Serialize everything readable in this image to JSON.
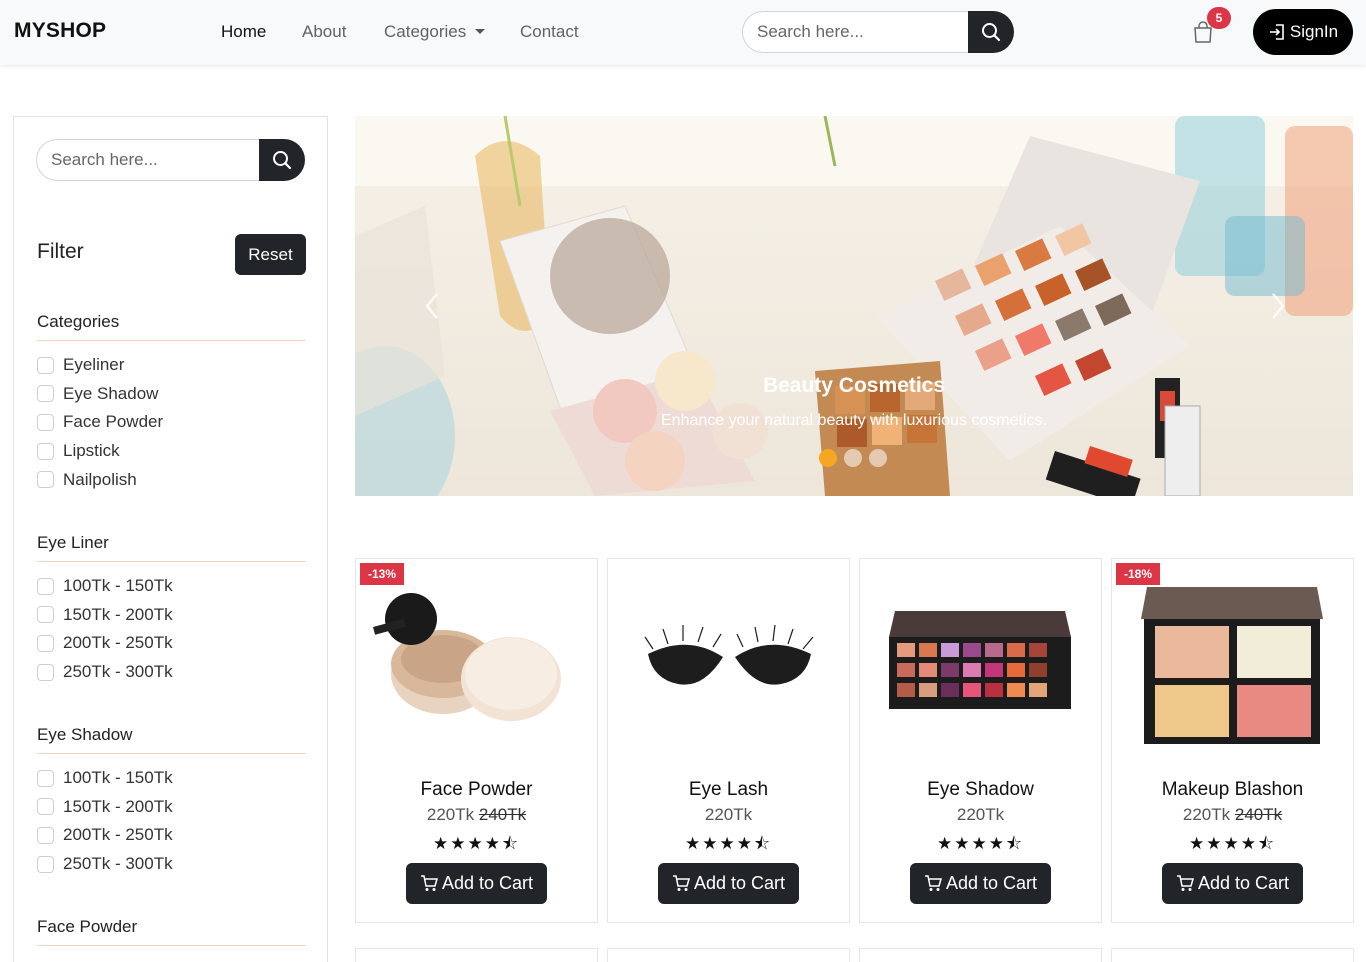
{
  "navbar": {
    "brand": "MYSHOP",
    "links": [
      "Home",
      "About",
      "Categories",
      "Contact"
    ],
    "search_placeholder": "Search here...",
    "cart_count": "5",
    "signin_label": "SignIn"
  },
  "sidebar": {
    "search_placeholder": "Search here...",
    "filter_title": "Filter",
    "reset_label": "Reset",
    "groups": [
      {
        "title": "Categories",
        "options": [
          "Eyeliner",
          "Eye Shadow",
          "Face Powder",
          "Lipstick",
          "Nailpolish"
        ]
      },
      {
        "title": "Eye Liner",
        "options": [
          "100Tk - 150Tk",
          "150Tk - 200Tk",
          "200Tk - 250Tk",
          "250Tk - 300Tk"
        ]
      },
      {
        "title": "Eye Shadow",
        "options": [
          "100Tk - 150Tk",
          "150Tk - 200Tk",
          "200Tk - 250Tk",
          "250Tk - 300Tk"
        ]
      },
      {
        "title": "Face Powder",
        "options": []
      }
    ]
  },
  "carousel": {
    "title": "Beauty Cosmetics",
    "text": "Enhance your natural beauty with luxurious cosmetics.",
    "active_slide": 1,
    "slide_count": 3
  },
  "products": [
    {
      "name": "Face Powder",
      "price": "220Tk",
      "old_price": "240Tk",
      "discount": "-13%",
      "rating": "★★★★⯪",
      "cart_label": "Add to Cart"
    },
    {
      "name": "Eye Lash",
      "price": "220Tk",
      "old_price": "",
      "discount": "",
      "rating": "★★★★⯪",
      "cart_label": "Add to Cart"
    },
    {
      "name": "Eye Shadow",
      "price": "220Tk",
      "old_price": "",
      "discount": "",
      "rating": "★★★★⯪",
      "cart_label": "Add to Cart"
    },
    {
      "name": "Makeup Blashon",
      "price": "220Tk",
      "old_price": "240Tk",
      "discount": "-18%",
      "rating": "★★★★⯪",
      "cart_label": "Add to Cart"
    }
  ],
  "colors": {
    "dark": "#212529",
    "badge": "#dc3545",
    "dot_active": "#f5a623"
  }
}
